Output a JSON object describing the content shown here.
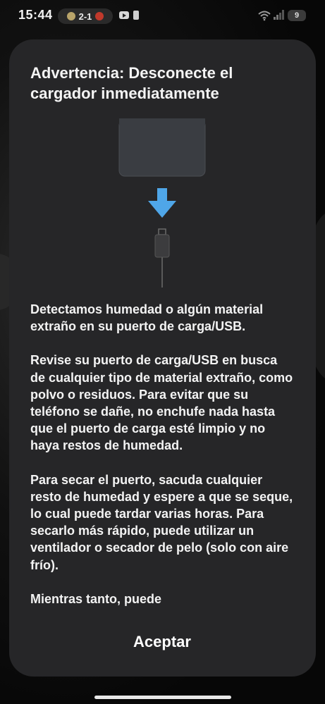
{
  "status_bar": {
    "time": "15:44",
    "score": "2-1",
    "battery_level": "9",
    "icons": [
      "team-badge-icon",
      "youtube-icon",
      "notification-icon",
      "wifi-icon",
      "signal-icon",
      "battery-icon"
    ]
  },
  "dialog": {
    "title": "Advertencia: Desconecte el cargador inmediatamente",
    "paragraphs": [
      "Detectamos humedad o algún material extraño en su puerto de carga/USB.",
      "Revise su puerto de carga/USB en busca de cualquier tipo de material extraño, como polvo o residuos. Para evitar que su teléfono se dañe, no enchufe nada hasta que el puerto de carga esté limpio y no haya restos de humedad.",
      "Para secar el puerto, sacuda cualquier resto de humedad y espere a que se seque, lo cual puede tardar varias horas. Para secarlo más rápido, puede utilizar un ventilador o secador de pelo (solo con aire frío).",
      "Mientras tanto, puede"
    ],
    "accept_label": "Aceptar"
  },
  "colors": {
    "dialog_bg": "#262628",
    "arrow": "#4fa6e8",
    "text": "#f3f3f3"
  }
}
